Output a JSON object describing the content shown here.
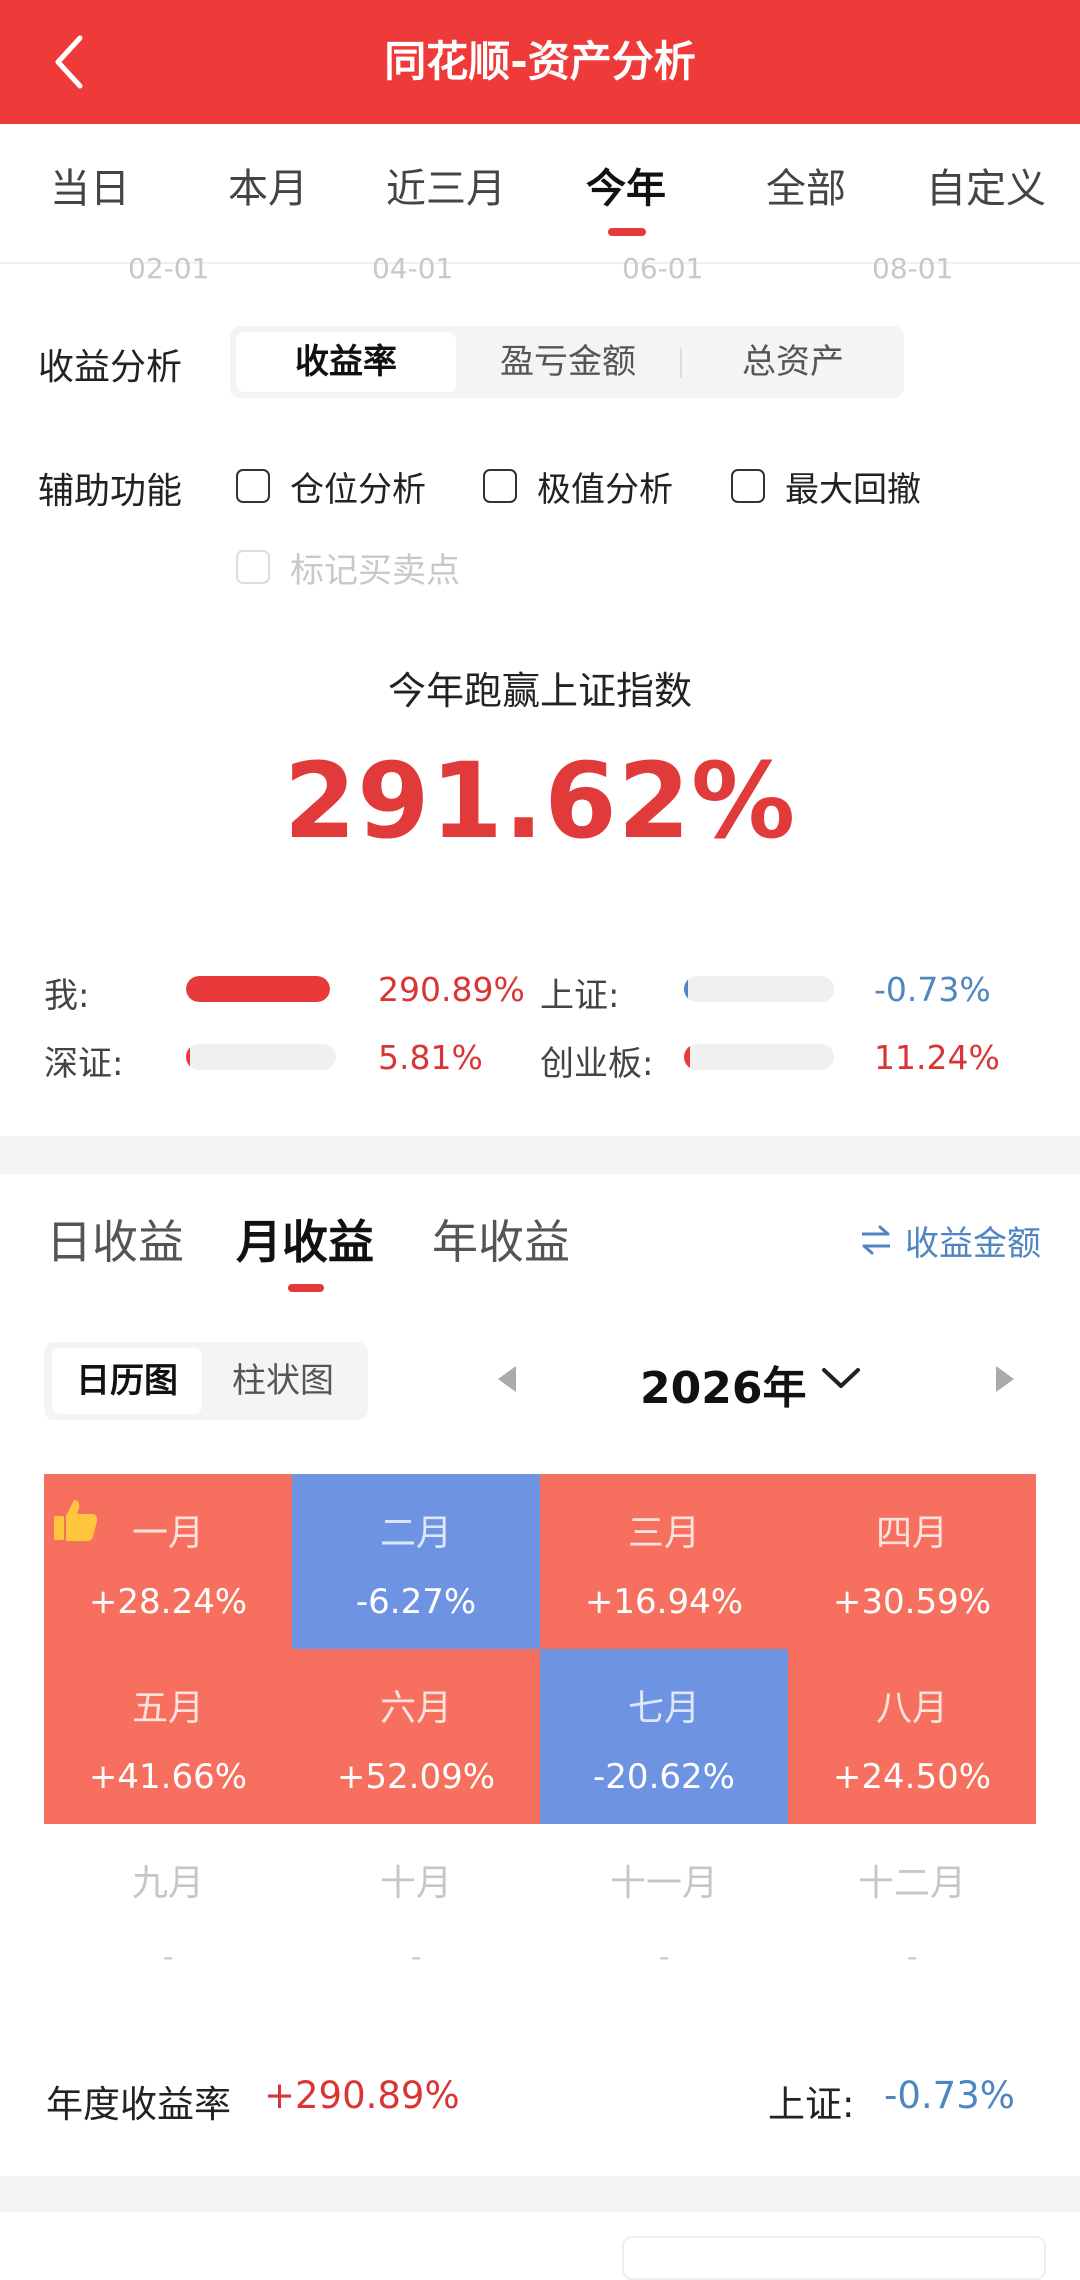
{
  "header": {
    "title": "同花顺-资产分析"
  },
  "period_tabs": [
    {
      "label": "当日",
      "active": false
    },
    {
      "label": "本月",
      "active": false
    },
    {
      "label": "近三月",
      "active": false
    },
    {
      "label": "今年",
      "active": true
    },
    {
      "label": "全部",
      "active": false
    },
    {
      "label": "自定义",
      "active": false
    }
  ],
  "axis_ticks": [
    "02-01",
    "04-01",
    "06-01",
    "08-01"
  ],
  "profit_analysis": {
    "label": "收益分析",
    "options": [
      "收益率",
      "盈亏金额",
      "总资产"
    ],
    "selected": "收益率"
  },
  "aux": {
    "label": "辅助功能",
    "options": [
      {
        "label": "仓位分析",
        "checked": false,
        "enabled": true
      },
      {
        "label": "极值分析",
        "checked": false,
        "enabled": true
      },
      {
        "label": "最大回撤",
        "checked": false,
        "enabled": true
      },
      {
        "label": "标记买卖点",
        "checked": false,
        "enabled": false
      }
    ]
  },
  "beat": {
    "label": "今年跑赢上证指数",
    "value": "291.62%"
  },
  "comparison": [
    {
      "label": "我:",
      "value": "290.89%",
      "fill": 1.0,
      "color": "#e83a3a"
    },
    {
      "label": "上证:",
      "value": "-0.73%",
      "fill": 0.01,
      "color": "#4f86c2"
    },
    {
      "label": "深证:",
      "value": "5.81%",
      "fill": 0.02,
      "color": "#e83a3a"
    },
    {
      "label": "创业板:",
      "value": "11.24%",
      "fill": 0.04,
      "color": "#e83a3a"
    }
  ],
  "return_tabs": [
    {
      "label": "日收益",
      "active": false
    },
    {
      "label": "月收益",
      "active": true
    },
    {
      "label": "年收益",
      "active": false
    }
  ],
  "amount_link": "收益金额",
  "view_toggle": {
    "options": [
      "日历图",
      "柱状图"
    ],
    "selected": "日历图"
  },
  "year": "2026年",
  "months": [
    {
      "name": "一月",
      "value": "+28.24%",
      "state": "pos"
    },
    {
      "name": "二月",
      "value": "-6.27%",
      "state": "neg"
    },
    {
      "name": "三月",
      "value": "+16.94%",
      "state": "pos"
    },
    {
      "name": "四月",
      "value": "+30.59%",
      "state": "pos"
    },
    {
      "name": "五月",
      "value": "+41.66%",
      "state": "pos"
    },
    {
      "name": "六月",
      "value": "+52.09%",
      "state": "pos"
    },
    {
      "name": "七月",
      "value": "-20.62%",
      "state": "neg"
    },
    {
      "name": "八月",
      "value": "+24.50%",
      "state": "pos"
    },
    {
      "name": "九月",
      "value": "-",
      "state": "empty"
    },
    {
      "name": "十月",
      "value": "-",
      "state": "empty"
    },
    {
      "name": "十一月",
      "value": "-",
      "state": "empty"
    },
    {
      "name": "十二月",
      "value": "-",
      "state": "empty"
    }
  ],
  "summary": {
    "annual_label": "年度收益率",
    "annual_value": "+290.89%",
    "index_label": "上证:",
    "index_value": "-0.73%"
  },
  "colors": {
    "brand": "#ef3a3a",
    "positive": "#f7705f",
    "negative": "#6f93e3",
    "index_blue": "#4f86c2"
  }
}
